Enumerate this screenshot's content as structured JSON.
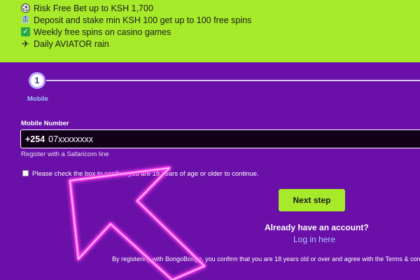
{
  "promo": {
    "items": [
      {
        "icon": "soccer-ball-icon",
        "text": "Risk Free Bet up to KSH 1,700"
      },
      {
        "icon": "bank-icon",
        "text": "Deposit and stake min KSH 100 get up to 100 free spins"
      },
      {
        "icon": "checkmark-icon",
        "text": "Weekly free spins on casino games"
      },
      {
        "icon": "airplane-icon",
        "text": "Daily AVIATOR rain"
      }
    ]
  },
  "stepper": {
    "step_number": "1",
    "step_label": "Mobile"
  },
  "form": {
    "mobile_label": "Mobile Number",
    "prefix": "+254",
    "phone_placeholder": "07xxxxxxxx",
    "hint": "Register with a Safaricom line",
    "checkbox_text": "Please check the box to confirm you are 18 years of age or older to continue.",
    "next_button": "Next step"
  },
  "account": {
    "question": "Already have an account?",
    "login_link": "Log in here"
  },
  "footer": {
    "text": "By registering with BongoBongo, you confirm that you are 18 years old or over and agree with the Terms & conditions"
  },
  "colors": {
    "promo_bg": "#a6ea2a",
    "page_bg": "#6a0fa8",
    "accent_green": "#a6ea2a",
    "link_blue": "#a9c9ff",
    "arrow_pink": "#ff3df0"
  }
}
